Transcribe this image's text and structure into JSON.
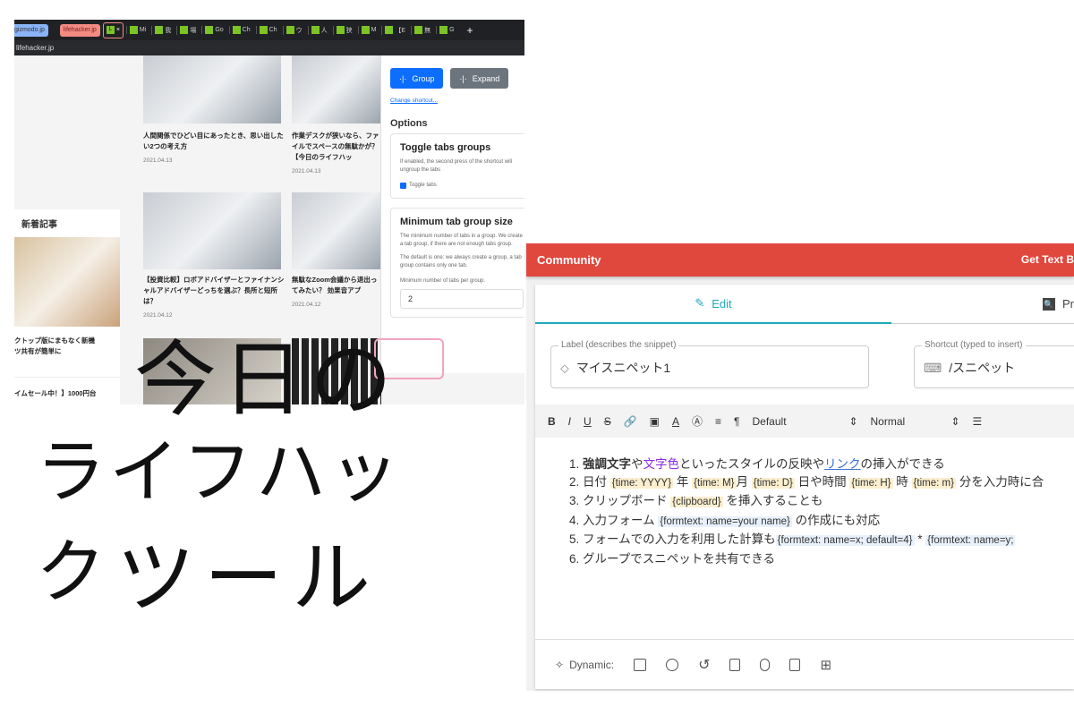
{
  "browser": {
    "tabs": {
      "gizmodo": "gizmodo.jp",
      "lifehacker": "lifehacker.jp",
      "close": "×",
      "others": [
        "Mi",
        "我",
        "場",
        "Go",
        "Ch",
        "Ch",
        "ウ",
        "人",
        "狭",
        "M",
        "【E",
        "無",
        "G"
      ],
      "new_tab": "+"
    },
    "address": "lifehacker.jp",
    "sidebar": {
      "heading": "新着記事",
      "article1": "クトップ版にまもなく新機\nツ共有が簡単に",
      "article2": "イムセール中！】1000円台"
    },
    "articles": [
      {
        "title": "人間関係でひどい目にあったとき、思い出したい2つの考え方",
        "date": "2021.04.13"
      },
      {
        "title": "作業デスクが狭いなら、ファイルでスペースの無駄かが？【今日のライフハッ",
        "date": "2021.04.13"
      },
      {
        "title": "【投資比較】ロボアドバイザーとファイナンシャルアドバイザーどっちを選ぶ？長所と短所は？",
        "date": "2021.04.12"
      },
      {
        "title": "無駄なZoom会議から退出ってみたい？ 効果音アプ",
        "date": "2021.04.12"
      }
    ],
    "popup": {
      "group": "Group",
      "expand": "Expand",
      "change_shortcut": "Change shortcut...",
      "options": "Options",
      "toggle_title": "Toggle tabs groups",
      "toggle_desc": "If enabled, the second press of the shortcut will ungroup the tabs",
      "toggle_label": "Toggle tabs",
      "toggle_checked": true,
      "min_title": "Minimum tab group size",
      "min_desc1": "The minimum number of tabs in a group. We create a tab group, if there are not enough tabs group.",
      "min_desc2": "The default is one: we always create a group, a tab group contains only one tab.",
      "min_label": "Minimum number of tabs per group.",
      "min_value": "2"
    }
  },
  "handwriting": {
    "line1": "今日の",
    "line2": "ライフハック",
    "line3": "ツール"
  },
  "app": {
    "header": {
      "title": "Community",
      "right": "Get Text B"
    },
    "tabs": {
      "edit": "Edit",
      "preview": "Pr"
    },
    "label_field": {
      "legend": "Label (describes the snippet)",
      "value": "マイスニペット1"
    },
    "shortcut_field": {
      "legend": "Shortcut (typed to insert)",
      "value": "/スニペット"
    },
    "toolbar": {
      "bold": "B",
      "italic": "I",
      "underline": "U",
      "strike": "S",
      "font": "Default",
      "size": "Normal"
    },
    "editor": {
      "l1": {
        "n": "1.",
        "bold": "強調文字",
        "a": "や",
        "color": "文字色",
        "b": "といったスタイルの反映や",
        "link": "リンク",
        "c": "の挿入ができる"
      },
      "l2": {
        "n": "2.",
        "a": "日付",
        "t1": "{time: YYYY}",
        "b": "年",
        "t2": "{time: M}",
        "c": "月",
        "t3": "{time: D}",
        "d": "日や時間",
        "t4": "{time: H}",
        "e": "時",
        "t5": "{time: m}",
        "f": "分を入力時に合"
      },
      "l3": {
        "n": "3.",
        "a": "クリップボード",
        "t": "{clipboard}",
        "b": "を挿入することも"
      },
      "l4": {
        "n": "4.",
        "a": "入力フォーム",
        "t": "{formtext: name=your name}",
        "b": "の作成にも対応"
      },
      "l5": {
        "n": "5.",
        "a": "フォームでの入力を利用した計算も",
        "t1": "{formtext: name=x; default=4}",
        "b": " * ",
        "t2": "{formtext: name=y;"
      },
      "l6": {
        "n": "6.",
        "a": "グループでスニペットを共有できる"
      }
    },
    "dynamic": {
      "label": "Dynamic:"
    }
  },
  "colors": {
    "accent": "#1fa9b8",
    "header": "#e0483e",
    "link": "#3b6fd8",
    "purple": "#8a2be2"
  }
}
